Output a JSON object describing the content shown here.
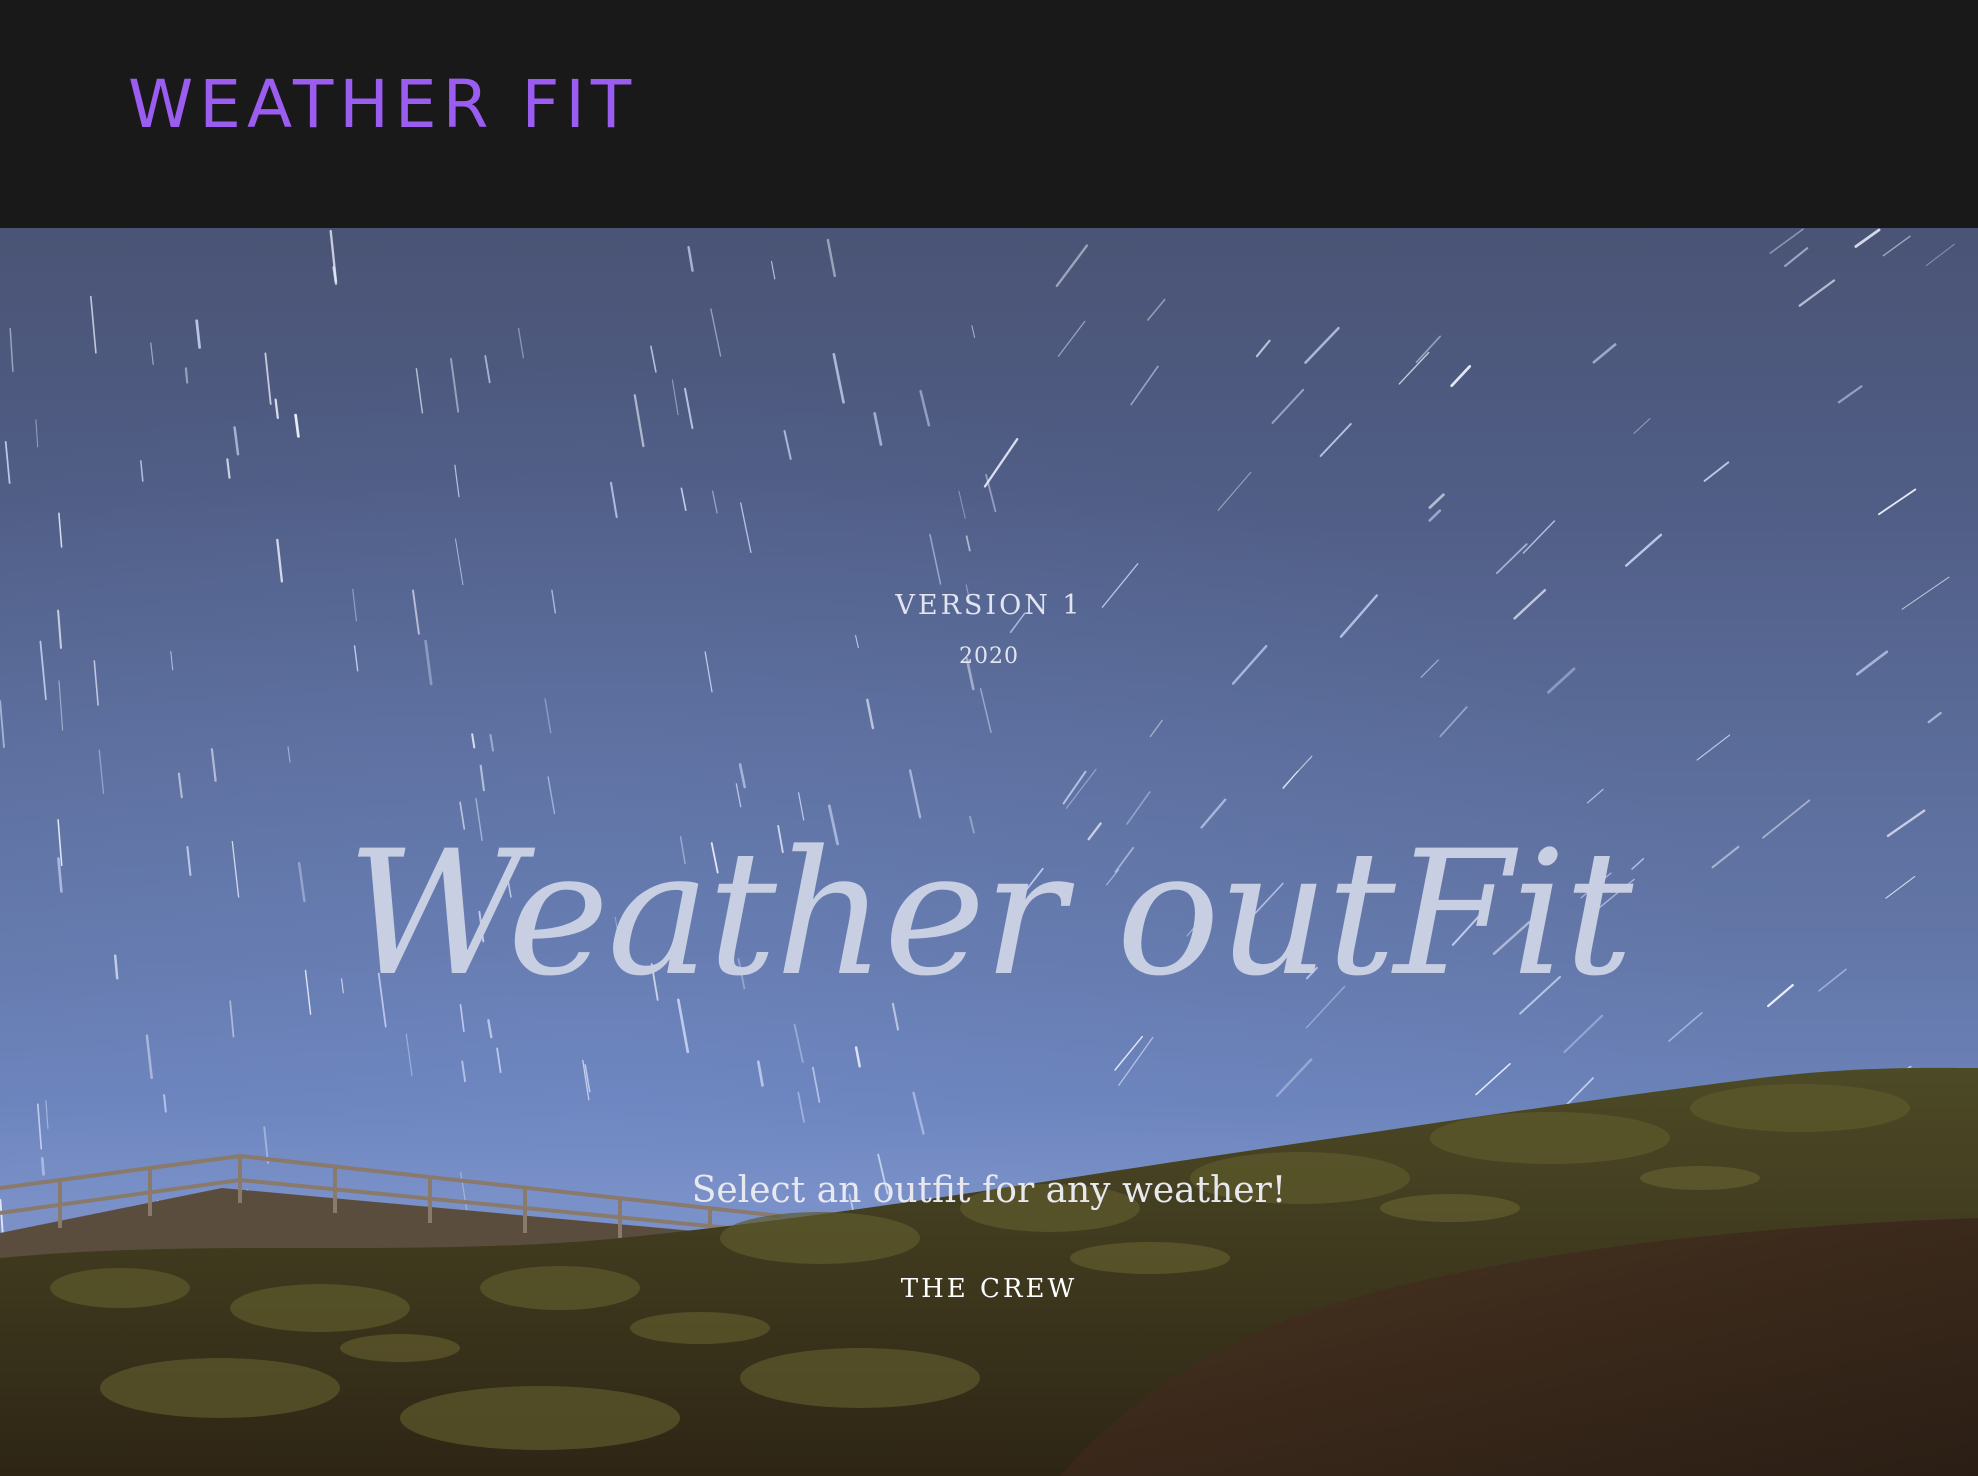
{
  "header": {
    "brand": "WEATHER FIT"
  },
  "hero": {
    "version_label": "VERSION 1",
    "year": "2020",
    "title": "Weather outFit",
    "tagline": "Select an outfit for any weather!",
    "crew_link": "THE CREW"
  },
  "colors": {
    "brand": "#9b5cf0",
    "header_bg": "#19191a",
    "sky_top": "#4a5475",
    "sky_bottom": "#7f91c2"
  }
}
